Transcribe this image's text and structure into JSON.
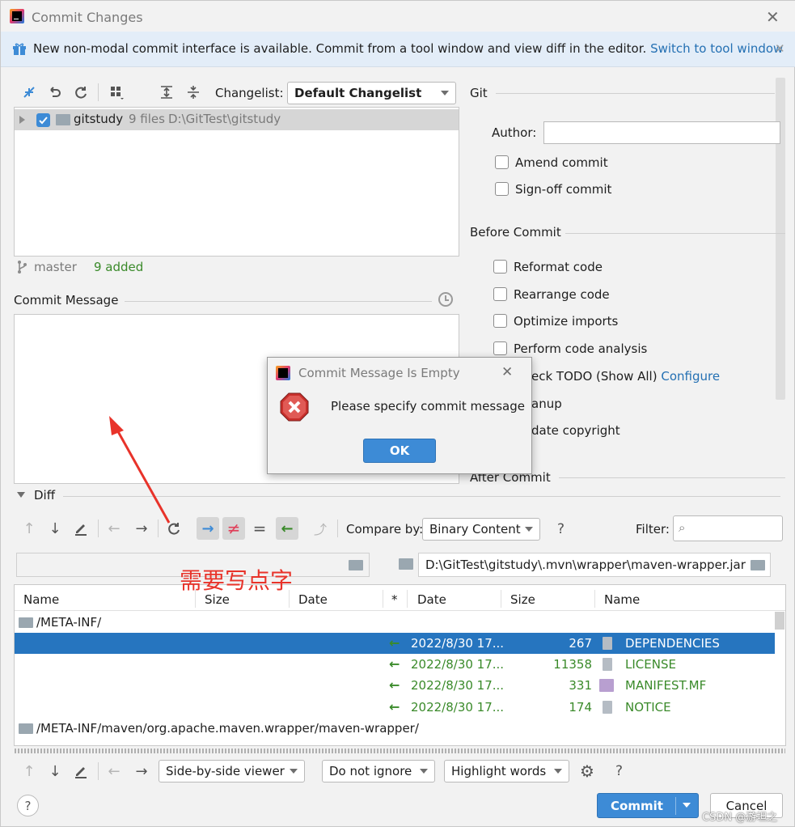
{
  "window": {
    "title": "Commit Changes"
  },
  "banner": {
    "text": "New non-modal commit interface is available. Commit from a tool window and view diff in the editor.",
    "link": "Switch to tool window"
  },
  "changes_toolbar": {
    "changelist_label": "Changelist:",
    "changelist_value": "Default Changelist"
  },
  "tree": {
    "root_name": "gitstudy",
    "root_count": "9 files",
    "root_path": "D:\\GitTest\\gitstudy"
  },
  "status": {
    "branch": "master",
    "added": "9 added"
  },
  "commit_message": {
    "label": "Commit Message",
    "value": ""
  },
  "git": {
    "section": "Git",
    "author_label": "Author:",
    "author_value": "",
    "amend": "Amend commit",
    "signoff": "Sign-off commit"
  },
  "before_commit": {
    "section": "Before Commit",
    "reformat": "Reformat code",
    "rearrange": "Rearrange code",
    "optimize": "Optimize imports",
    "analysis": "Perform code analysis",
    "todo": "eck TODO (Show All)",
    "todo_link": "Configure",
    "cleanup": "anup",
    "copyright": "date copyright"
  },
  "after_commit": {
    "section": "After Commit"
  },
  "dialog": {
    "title": "Commit Message Is Empty",
    "message": "Please specify commit message",
    "ok": "OK"
  },
  "annotation": {
    "text": "需要写点字"
  },
  "diff": {
    "section": "Diff",
    "compare_label": "Compare by:",
    "compare_value": "Binary Content",
    "help": "?",
    "filter_label": "Filter:",
    "right_path": "D:\\GitTest\\gitstudy\\.mvn\\wrapper\\maven-wrapper.jar",
    "columns": [
      "Name",
      "Size",
      "Date",
      "*",
      "Date",
      "Size",
      "Name"
    ],
    "folder1": "/META-INF/",
    "rows": [
      {
        "date": "2022/8/30 17...",
        "size": "267",
        "name": "DEPENDENCIES"
      },
      {
        "date": "2022/8/30 17...",
        "size": "11358",
        "name": "LICENSE"
      },
      {
        "date": "2022/8/30 17...",
        "size": "331",
        "name": "MANIFEST.MF"
      },
      {
        "date": "2022/8/30 17...",
        "size": "174",
        "name": "NOTICE"
      }
    ],
    "folder2": "/META-INF/maven/org.apache.maven.wrapper/maven-wrapper/"
  },
  "bottom_toolbar": {
    "viewer": "Side-by-side viewer",
    "ignore": "Do not ignore",
    "highlight": "Highlight words",
    "help": "?"
  },
  "footer": {
    "help": "?",
    "commit": "Commit",
    "cancel": "Cancel",
    "watermark": "CSDN @游坦之"
  },
  "colors": {
    "accent": "#3d8bd6",
    "selection": "#2675bf",
    "added_green": "#3a8a2a",
    "annotation_red": "#e8332a"
  }
}
